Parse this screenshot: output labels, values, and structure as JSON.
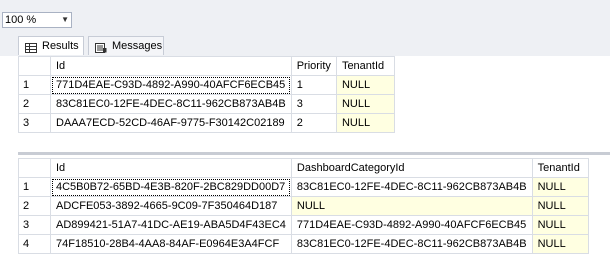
{
  "toolbar": {
    "zoom_value": "100 %"
  },
  "tabs": {
    "results_label": "Results",
    "messages_label": "Messages"
  },
  "grid1": {
    "headers": [
      "Id",
      "Priority",
      "TenantId"
    ],
    "rows": [
      {
        "n": "1",
        "id": "771D4EAE-C93D-4892-A990-40AFCF6ECB45",
        "priority": "1",
        "tenant": "NULL"
      },
      {
        "n": "2",
        "id": "83C81EC0-12FE-4DEC-8C11-962CB873AB4B",
        "priority": "3",
        "tenant": "NULL"
      },
      {
        "n": "3",
        "id": "DAAA7ECD-52CD-46AF-9775-F30142C02189",
        "priority": "2",
        "tenant": "NULL"
      }
    ]
  },
  "grid2": {
    "headers": [
      "Id",
      "DashboardCategoryId",
      "TenantId"
    ],
    "rows": [
      {
        "n": "1",
        "id": "4C5B0B72-65BD-4E3B-820F-2BC829DD00D7",
        "cat": "83C81EC0-12FE-4DEC-8C11-962CB873AB4B",
        "tenant": "NULL"
      },
      {
        "n": "2",
        "id": "ADCFE053-3892-4665-9C09-7F350464D187",
        "cat": "NULL",
        "tenant": "NULL"
      },
      {
        "n": "3",
        "id": "AD899421-51A7-41DC-AE19-ABA5D4F43EC4",
        "cat": "771D4EAE-C93D-4892-A990-40AFCF6ECB45",
        "tenant": "NULL"
      },
      {
        "n": "4",
        "id": "74F18510-28B4-4AA8-84AF-E0964E3A4FCF",
        "cat": "83C81EC0-12FE-4DEC-8C11-962CB873AB4B",
        "tenant": "NULL"
      }
    ]
  },
  "colors": {
    "null_cell_bg": "#ffffe1",
    "toolbar_bg": "#eef0f4"
  }
}
